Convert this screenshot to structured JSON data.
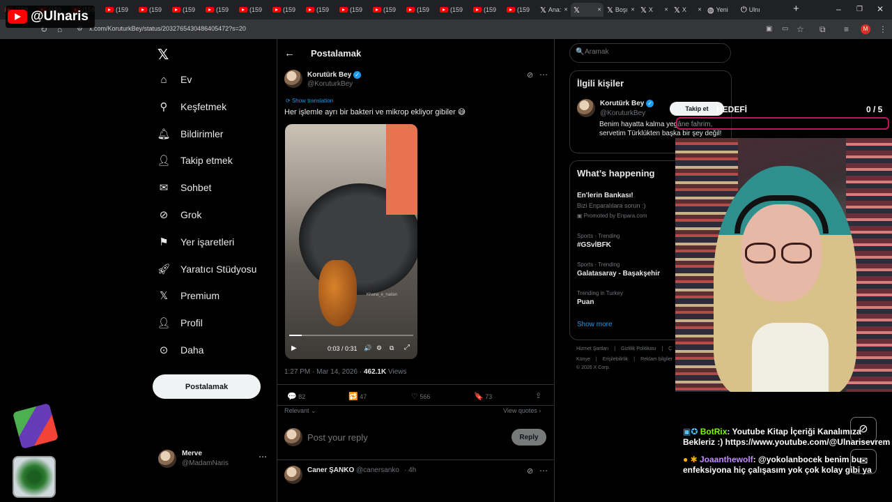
{
  "browser": {
    "tabs": [
      {
        "label": "(159",
        "icon": "youtube-icon"
      },
      {
        "label": "(159",
        "icon": "youtube-icon"
      },
      {
        "label": "(159",
        "icon": "youtube-icon"
      },
      {
        "label": "(159",
        "icon": "youtube-icon"
      },
      {
        "label": "(159",
        "icon": "youtube-icon"
      },
      {
        "label": "(159",
        "icon": "youtube-icon"
      },
      {
        "label": "(159",
        "icon": "youtube-icon"
      },
      {
        "label": "(159",
        "icon": "youtube-icon"
      },
      {
        "label": "(159",
        "icon": "youtube-icon"
      },
      {
        "label": "(159",
        "icon": "youtube-icon"
      },
      {
        "label": "(159",
        "icon": "youtube-icon"
      },
      {
        "label": "(159",
        "icon": "youtube-icon"
      },
      {
        "label": "(159",
        "icon": "youtube-icon"
      },
      {
        "label": "(159",
        "icon": "youtube-icon"
      },
      {
        "label": "(159",
        "icon": "youtube-icon"
      },
      {
        "label": "(159",
        "icon": "youtube-icon"
      },
      {
        "label": "Ana:",
        "icon": "x-icon"
      },
      {
        "label": "",
        "icon": "x-icon"
      },
      {
        "label": "Boşı",
        "icon": "x-icon"
      },
      {
        "label": "X",
        "icon": "x-icon"
      },
      {
        "label": "X",
        "icon": "x-icon"
      },
      {
        "label": "Yeni",
        "icon": "globe-icon"
      },
      {
        "label": "Ulnı",
        "icon": "power-icon"
      }
    ],
    "url": "x.com/KoruturkBey/status/2032765430486405472?s=20"
  },
  "channel_overlay": {
    "name": "@Ulnaris"
  },
  "sidebar": {
    "items": [
      {
        "label": "Ev",
        "icon": "home-icon"
      },
      {
        "label": "Keşfetmek",
        "icon": "search-icon"
      },
      {
        "label": "Bildirimler",
        "icon": "bell-icon"
      },
      {
        "label": "Takip etmek",
        "icon": "follow-icon"
      },
      {
        "label": "Sohbet",
        "icon": "mail-icon"
      },
      {
        "label": "Grok",
        "icon": "grok-icon"
      },
      {
        "label": "Yer işaretleri",
        "icon": "bookmark-icon"
      },
      {
        "label": "Yaratıcı Stüdyosu",
        "icon": "rocket-icon"
      },
      {
        "label": "Premium",
        "icon": "x-logo-icon"
      },
      {
        "label": "Profil",
        "icon": "profile-icon"
      },
      {
        "label": "Daha",
        "icon": "more-icon"
      }
    ],
    "post_button": "Postalamak",
    "account": {
      "name": "Merve",
      "handle": "@MadamNaris"
    }
  },
  "post": {
    "header_title": "Postalamak",
    "author": {
      "name": "Korutürk Bey",
      "handle": "@KoruturkBey"
    },
    "show_translation": "Show translation",
    "text": "Her işlemle ayrı bir bakteri ve mikrop ekliyor gibiler 😅",
    "video": {
      "time": "0:03 / 0:31",
      "watermark": "Khana_e_nadan",
      "progress_fraction": 0.1
    },
    "timestamp": "1:27 PM · Mar 14, 2026 · ",
    "views_count": "462.1K",
    "views_label": " Views",
    "stats": {
      "replies": "82",
      "reposts": "47",
      "likes": "566",
      "bookmarks": "73"
    },
    "sort_label": "Relevant",
    "view_quotes": "View quotes",
    "reply_placeholder": "Post your reply",
    "reply_button": "Reply",
    "next_reply": {
      "name": "Caner ŞANKO",
      "handle": "@canersanko",
      "time": "· 4h"
    }
  },
  "right": {
    "search_placeholder": "Aramak",
    "relevant_people": {
      "title": "İlgili kişiler",
      "name": "Korutürk Bey",
      "handle": "@KoruturkBey",
      "follow_button": "Takip et",
      "bio": "Benim hayatta kalma yegâne fahrim, servetim Türklükten başka bir şey değil!"
    },
    "happening": {
      "title": "What’s happening",
      "items": [
        {
          "meta": "",
          "name": "En'lerin Bankası!",
          "sub": "Bizi Enparalılara sorun :)",
          "promo": "Promoted by Enpara.com"
        },
        {
          "meta": "Sports · Trending",
          "name": "#GSvİBFK"
        },
        {
          "meta": "Sports · Trending",
          "name": "Galatasaray - Başakşehir"
        },
        {
          "meta": "Trending in Turkey",
          "name": "Puan"
        }
      ],
      "show_more": "Show more"
    },
    "footer": {
      "line1": [
        "Hizmet Şartları",
        "|",
        "Gizlilik Politikası",
        "|",
        "Ç"
      ],
      "line2": [
        "Künye",
        "|",
        "Erişilebilirlik",
        "|",
        "Reklam bilgiler"
      ],
      "copyright": "© 2026 X Corp."
    }
  },
  "stream": {
    "goal_label": "HEDEFİ",
    "goal_count": "0 / 5",
    "goal_progress": 0,
    "chat": [
      {
        "user": "BotRix",
        "message": ": Youtube Kitap İçeriği Kanalımıza Bekleriz :) https://www.youtube.com/@Ulnarisevrem",
        "user_color": "#7CFC00"
      },
      {
        "user": "Joaanthewolf",
        "message": ": @yokolanbocek benim bu enfeksiyona hiç çalışasım yok çok kolay gibi ya",
        "user_color": "#c28cff"
      }
    ]
  }
}
